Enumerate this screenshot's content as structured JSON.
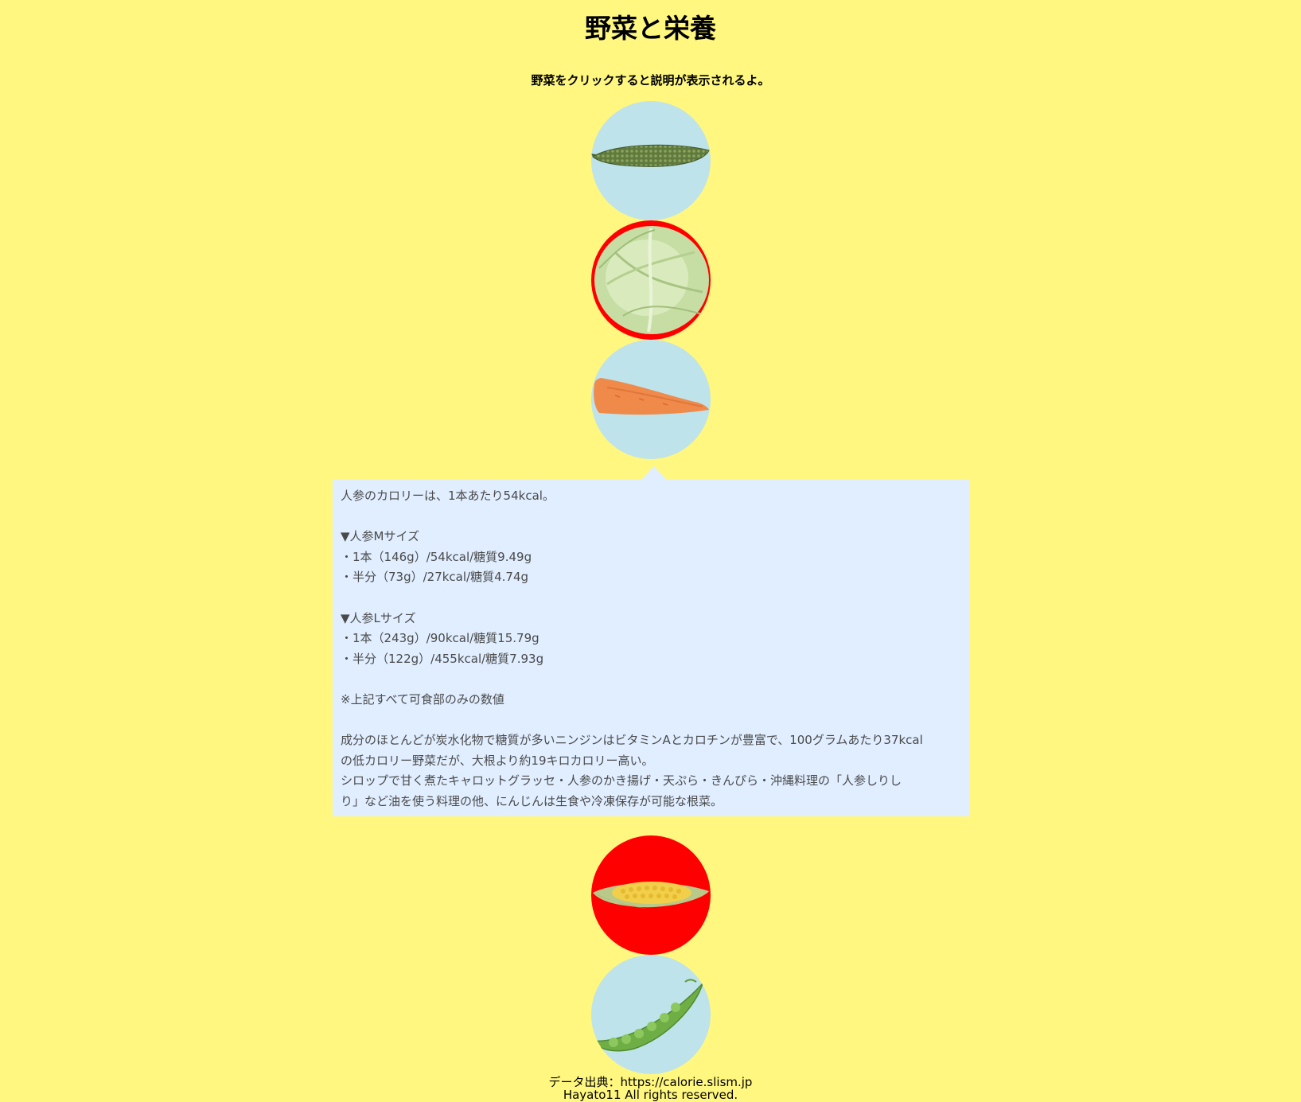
{
  "header": {
    "title": "野菜と栄養",
    "subtitle": "野菜をクリックすると説明が表示されるよ。"
  },
  "vegetables": [
    {
      "name": "bitter-melon",
      "icon": "bitter-melon-icon",
      "background": "#bee3ea"
    },
    {
      "name": "cabbage",
      "icon": "cabbage-icon",
      "background": "#ff0000"
    },
    {
      "name": "carrot",
      "icon": "carrot-icon",
      "background": "#bee3ea"
    },
    {
      "name": "corn",
      "icon": "corn-icon",
      "background": "#ff0000"
    },
    {
      "name": "snap-pea",
      "icon": "snap-pea-icon",
      "background": "#bee3ea"
    }
  ],
  "popup": {
    "intro": "人参のカロリーは、1本あたり54kcal。",
    "m_heading": "▼人参Mサイズ",
    "m_line1": "・1本（146g）/54kcal/糖質9.49g",
    "m_line2": "・半分（73g）/27kcal/糖質4.74g",
    "l_heading": "▼人参Lサイズ",
    "l_line1": "・1本（243g）/90kcal/糖質15.79g",
    "l_line2": "・半分（122g）/455kcal/糖質7.93g",
    "note": "※上記すべて可食部のみの数値",
    "desc1": "成分のほとんどが炭水化物で糖質が多いニンジンはビタミンAとカロチンが豊富で、100グラムあたり37kcal",
    "desc2": "の低カロリー野菜だが、大根より約19キロカロリー高い。",
    "desc3": "シロップで甘く煮たキャロットグラッセ・人参のかき揚げ・天ぷら・きんぴら・沖縄料理の「人参しりし",
    "desc4": "り」など油を使う料理の他、にんじんは生食や冷凍保存が可能な根菜。"
  },
  "footer": {
    "source": "データ出典：https://calorie.slism.jp",
    "copyright": "Hayato11 All rights reserved."
  }
}
